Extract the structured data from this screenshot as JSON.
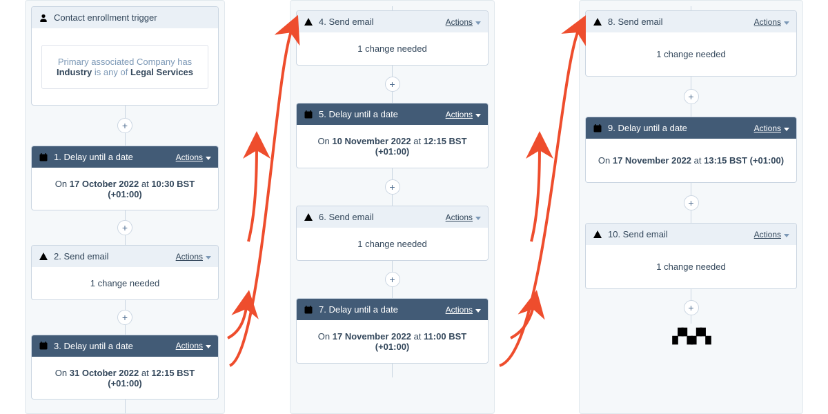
{
  "labels": {
    "actions": "Actions",
    "plus": "+"
  },
  "trigger": {
    "title": "Contact enrollment trigger",
    "criteria_prefix": "Primary associated Company has",
    "criteria_field": "Industry",
    "criteria_joiner": "is any of",
    "criteria_value": "Legal Services"
  },
  "steps": {
    "s1": {
      "title": "1. Delay until a date",
      "body_prefix": "On",
      "body_date": "17 October 2022",
      "body_mid": "at",
      "body_time": "10:30 BST (+01:00)"
    },
    "s2": {
      "title": "2. Send email",
      "body": "1 change needed"
    },
    "s3": {
      "title": "3. Delay until a date",
      "body_prefix": "On",
      "body_date": "31 October 2022",
      "body_mid": "at",
      "body_time": "12:15 BST (+01:00)"
    },
    "s4": {
      "title": "4. Send email",
      "body": "1 change needed"
    },
    "s5": {
      "title": "5. Delay until a date",
      "body_prefix": "On",
      "body_date": "10 November 2022",
      "body_mid": "at",
      "body_time": "12:15 BST (+01:00)"
    },
    "s6": {
      "title": "6. Send email",
      "body": "1 change needed"
    },
    "s7": {
      "title": "7. Delay until a date",
      "body_prefix": "On",
      "body_date": "17 November 2022",
      "body_mid": "at",
      "body_time": "11:00 BST (+01:00)"
    },
    "s8": {
      "title": "8. Send email",
      "body": "1 change needed"
    },
    "s9": {
      "title": "9. Delay until a date",
      "body_prefix": "On",
      "body_date": "17 November 2022",
      "body_mid": "at",
      "body_time": "13:15 BST (+01:00)"
    },
    "s10": {
      "title": "10. Send email",
      "body": "1 change needed"
    }
  }
}
